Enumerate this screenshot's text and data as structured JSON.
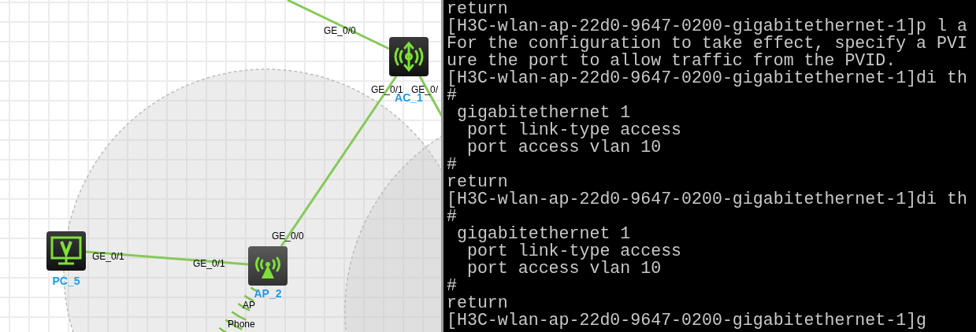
{
  "topology": {
    "nodes": [
      {
        "kind": "ac",
        "label": "AC_1"
      },
      {
        "kind": "pc",
        "label": "PC_5"
      },
      {
        "kind": "ap",
        "label": "AP_2"
      }
    ],
    "links": [
      {
        "ports": [
          "GE_0/0"
        ]
      },
      {
        "ports": [
          "GE_0/1",
          "GE_0/0"
        ]
      },
      {
        "ports": [
          "GE_0/"
        ]
      },
      {
        "ports": [
          "GE_0/1",
          "GE_0/1"
        ]
      }
    ],
    "wireless_labels": [
      "AP",
      "Phone"
    ]
  },
  "terminal": {
    "lines": [
      "return",
      "[H3C-wlan-ap-22d0-9647-0200-gigabitethernet-1]p l a",
      "For the configuration to take effect, specify a PVI",
      "ure the port to allow traffic from the PVID.",
      "[H3C-wlan-ap-22d0-9647-0200-gigabitethernet-1]di th",
      "#",
      " gigabitethernet 1",
      "  port link-type access",
      "  port access vlan 10",
      "#",
      "return",
      "[H3C-wlan-ap-22d0-9647-0200-gigabitethernet-1]di th",
      "#",
      " gigabitethernet 1",
      "  port link-type access",
      "  port access vlan 10",
      "#",
      "return",
      "[H3C-wlan-ap-22d0-9647-0200-gigabitethernet-1]g"
    ]
  }
}
